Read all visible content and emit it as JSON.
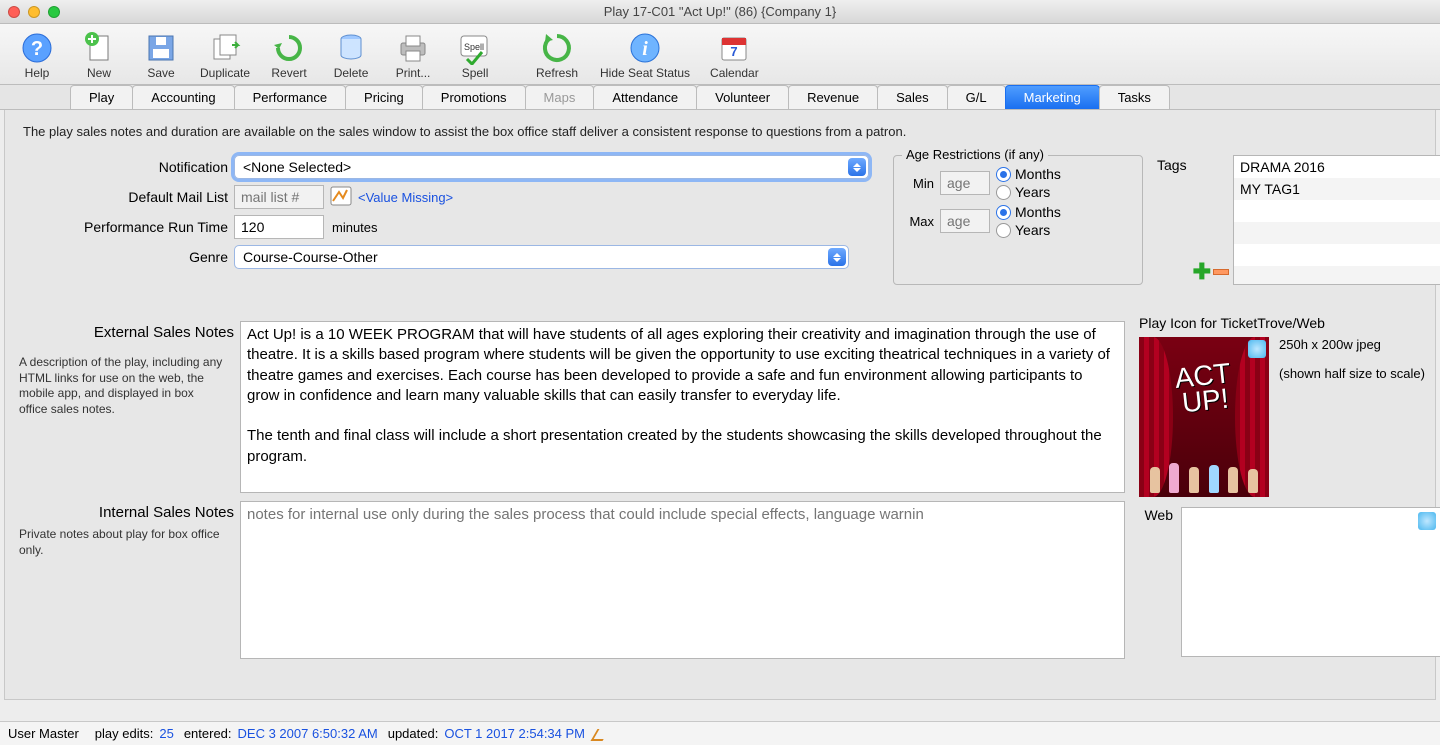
{
  "window_title": "Play 17-C01 \"Act Up!\" (86) {Company 1}",
  "toolbar": {
    "help": "Help",
    "new": "New",
    "save": "Save",
    "duplicate": "Duplicate",
    "revert": "Revert",
    "delete": "Delete",
    "print": "Print...",
    "spell": "Spell",
    "refresh": "Refresh",
    "hide_seat": "Hide Seat Status",
    "calendar": "Calendar"
  },
  "tabs": {
    "play": "Play",
    "accounting": "Accounting",
    "performance": "Performance",
    "pricing": "Pricing",
    "promotions": "Promotions",
    "maps": "Maps",
    "attendance": "Attendance",
    "volunteer": "Volunteer",
    "revenue": "Revenue",
    "sales": "Sales",
    "gl": "G/L",
    "marketing": "Marketing",
    "tasks": "Tasks"
  },
  "hint": "The play sales notes and duration are available on the sales window to assist the box office staff deliver a consistent response to questions from a patron.",
  "form": {
    "notification_label": "Notification",
    "notification_value": "<None Selected>",
    "default_mail_label": "Default Mail List",
    "default_mail_placeholder": "mail list #",
    "value_missing": "<Value Missing>",
    "runtime_label": "Performance Run Time",
    "runtime_value": "120",
    "runtime_unit": "minutes",
    "genre_label": "Genre",
    "genre_value": "Course-Course-Other"
  },
  "age": {
    "legend": "Age Restrictions (if any)",
    "min_label": "Min",
    "max_label": "Max",
    "age_placeholder": "age",
    "months": "Months",
    "years": "Years"
  },
  "tags": {
    "label": "Tags",
    "items": [
      "DRAMA 2016",
      "MY TAG1"
    ]
  },
  "notes": {
    "external_label": "External Sales Notes",
    "external_sub": "A description of the play, including any HTML links for use on the web, the mobile app, and displayed in box office sales notes.",
    "external_text": "Act Up! is a 10 WEEK PROGRAM that will have students of all ages exploring their creativity and imagination through the use of theatre. It is a skills based program where students will be given the opportunity to use exciting theatrical techniques in a variety of theatre games and exercises. Each course has been developed to provide a safe and fun environment allowing participants to grow in confidence and learn many valuable skills that can easily transfer to everyday life.\n\nThe tenth and final class will include a short presentation created by the students showcasing the skills developed throughout the program.",
    "internal_label": "Internal Sales Notes",
    "internal_sub": "Private notes about play for box office only.",
    "internal_placeholder": "notes for internal use only during the sales process that could include special effects, language warnin"
  },
  "icon_area": {
    "header": "Play Icon for TicketTrove/Web",
    "dims": "250h x 200w jpeg",
    "shown": "(shown half size to scale)",
    "web_label": "Web"
  },
  "status": {
    "user": "User Master",
    "edits_label": "play edits:",
    "edits": "25",
    "entered_label": "entered:",
    "entered": "DEC 3 2007 6:50:32 AM",
    "updated_label": "updated:",
    "updated": "OCT 1 2017 2:54:34 PM"
  }
}
